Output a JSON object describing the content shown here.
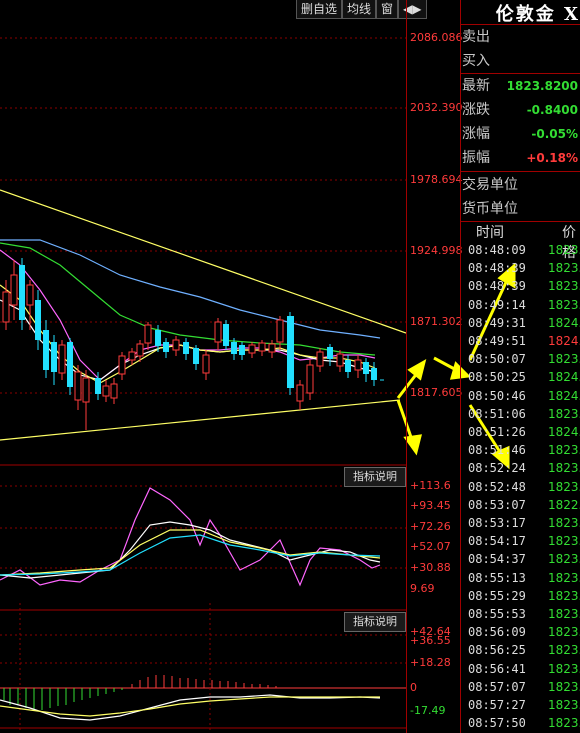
{
  "toolbar": {
    "buttons": [
      "删自选",
      "均线",
      "窗",
      "◀▶"
    ]
  },
  "indicator_buttons": [
    "指标说明",
    "指标说明"
  ],
  "price_axis": [
    {
      "text": "2086.086",
      "color": "#ff3b3b"
    },
    {
      "text": "2032.390",
      "color": "#ff3b3b"
    },
    {
      "text": "1978.694",
      "color": "#ff3b3b"
    },
    {
      "text": "1924.998",
      "color": "#ff3b3b"
    },
    {
      "text": "1871.302",
      "color": "#ff3b3b"
    },
    {
      "text": "1817.605",
      "color": "#ff3b3b"
    }
  ],
  "indicator1_axis": [
    {
      "text": "+113.6",
      "color": "#ff3b3b"
    },
    {
      "text": "+93.45",
      "color": "#ff3b3b"
    },
    {
      "text": "+72.26",
      "color": "#ff3b3b"
    },
    {
      "text": "+52.07",
      "color": "#ff3b3b"
    },
    {
      "text": "+30.88",
      "color": "#ff3b3b"
    },
    {
      "text": "9.69",
      "color": "#ff3b3b"
    }
  ],
  "indicator2_axis": [
    {
      "text": "+42.64",
      "color": "#ff3b3b"
    },
    {
      "text": "+36.55",
      "color": "#ff3b3b"
    },
    {
      "text": "+18.28",
      "color": "#ff3b3b"
    },
    {
      "text": "0",
      "color": "#ff3b3b"
    },
    {
      "text": "-17.49",
      "color": "#33dd33"
    }
  ],
  "quote": {
    "title": "伦敦金 X",
    "rows": [
      {
        "label": "卖出",
        "value": "",
        "color": "#ffffff"
      },
      {
        "label": "买入",
        "value": "",
        "color": "#ffffff"
      },
      {
        "label": "最新",
        "value": "1823.8200",
        "color": "#33dd33"
      },
      {
        "label": "涨跌",
        "value": "-0.8400",
        "color": "#33dd33"
      },
      {
        "label": "涨幅",
        "value": "-0.05%",
        "color": "#33dd33"
      },
      {
        "label": "振幅",
        "value": "+0.18%",
        "color": "#ff3b3b"
      },
      {
        "label": "交易单位",
        "value": "",
        "color": "#ffffff"
      },
      {
        "label": "货币单位",
        "value": "",
        "color": "#ffffff"
      }
    ]
  },
  "ticks_header": {
    "time": "时间",
    "price": "价格"
  },
  "ticks": [
    {
      "time": "08:48:09",
      "price": "1823.",
      "color": "#33dd33"
    },
    {
      "time": "08:48:39",
      "price": "1823.",
      "color": "#33dd33"
    },
    {
      "time": "08:48:39",
      "price": "1823.",
      "color": "#33dd33"
    },
    {
      "time": "08:49:14",
      "price": "1823.",
      "color": "#33dd33"
    },
    {
      "time": "08:49:31",
      "price": "1824.",
      "color": "#33dd33"
    },
    {
      "time": "08:49:51",
      "price": "1824.",
      "color": "#ff3b3b"
    },
    {
      "time": "08:50:07",
      "price": "1823.",
      "color": "#33dd33"
    },
    {
      "time": "08:50:25",
      "price": "1824.",
      "color": "#33dd33"
    },
    {
      "time": "08:50:46",
      "price": "1824.",
      "color": "#33dd33"
    },
    {
      "time": "08:51:06",
      "price": "1823.",
      "color": "#33dd33"
    },
    {
      "time": "08:51:26",
      "price": "1824.",
      "color": "#33dd33"
    },
    {
      "time": "08:51:46",
      "price": "1823.",
      "color": "#33dd33"
    },
    {
      "time": "08:52:24",
      "price": "1823.",
      "color": "#33dd33"
    },
    {
      "time": "08:52:48",
      "price": "1823.",
      "color": "#33dd33"
    },
    {
      "time": "08:53:07",
      "price": "1822.",
      "color": "#33dd33"
    },
    {
      "time": "08:53:17",
      "price": "1823.",
      "color": "#33dd33"
    },
    {
      "time": "08:54:17",
      "price": "1823.",
      "color": "#33dd33"
    },
    {
      "time": "08:54:37",
      "price": "1823.",
      "color": "#33dd33"
    },
    {
      "time": "08:55:13",
      "price": "1823.",
      "color": "#33dd33"
    },
    {
      "time": "08:55:29",
      "price": "1823.",
      "color": "#33dd33"
    },
    {
      "time": "08:55:53",
      "price": "1823.",
      "color": "#33dd33"
    },
    {
      "time": "08:56:09",
      "price": "1823.",
      "color": "#33dd33"
    },
    {
      "time": "08:56:25",
      "price": "1823.",
      "color": "#33dd33"
    },
    {
      "time": "08:56:41",
      "price": "1823.",
      "color": "#33dd33"
    },
    {
      "time": "08:57:07",
      "price": "1823.",
      "color": "#33dd33"
    },
    {
      "time": "08:57:27",
      "price": "1823.",
      "color": "#33dd33"
    },
    {
      "time": "08:57:50",
      "price": "1823.",
      "color": "#33dd33"
    }
  ],
  "colors": {
    "up": "#ff3b3b",
    "down": "#22e0ff",
    "grid": "#a00000",
    "arrow": "#ffff00"
  }
}
